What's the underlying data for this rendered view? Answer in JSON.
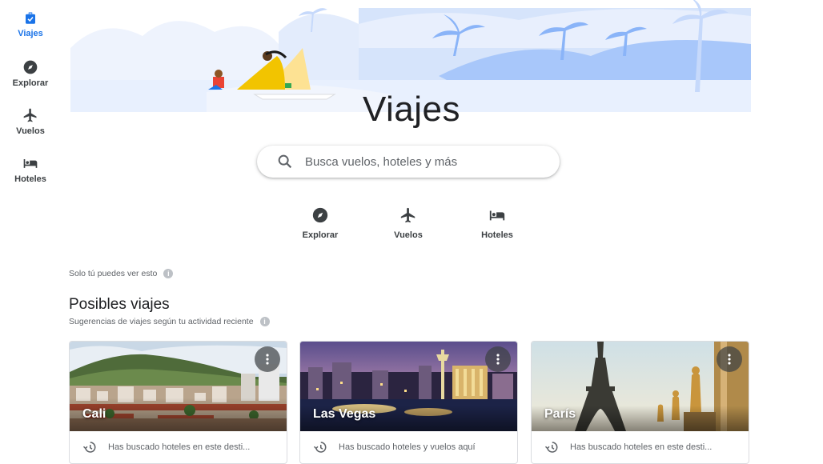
{
  "nav": {
    "items": [
      {
        "label": "Viajes",
        "icon": "suitcase-icon",
        "active": true
      },
      {
        "label": "Explorar",
        "icon": "compass-icon",
        "active": false
      },
      {
        "label": "Vuelos",
        "icon": "airplane-icon",
        "active": false
      },
      {
        "label": "Hoteles",
        "icon": "bed-icon",
        "active": false
      }
    ]
  },
  "header": {
    "title": "Viajes"
  },
  "search": {
    "placeholder": "Busca vuelos, hoteles y más",
    "icon": "search-icon"
  },
  "quick_links": [
    {
      "label": "Explorar",
      "icon": "compass-icon"
    },
    {
      "label": "Vuelos",
      "icon": "airplane-icon"
    },
    {
      "label": "Hoteles",
      "icon": "bed-icon"
    }
  ],
  "privacy_note": "Solo tú puedes ver esto",
  "section": {
    "title": "Posibles viajes",
    "subtitle": "Sugerencias de viajes según tu actividad reciente"
  },
  "cards": [
    {
      "city": "Cali",
      "history": "Has buscado hoteles en este desti..."
    },
    {
      "city": "Las Vegas",
      "history": "Has buscado hoteles y vuelos aquí"
    },
    {
      "city": "París",
      "history": "Has buscado hoteles en este desti..."
    }
  ],
  "colors": {
    "accent": "#1a73e8",
    "text": "#202124",
    "muted": "#5f6368",
    "hero_blue": "#a8c7fa"
  }
}
